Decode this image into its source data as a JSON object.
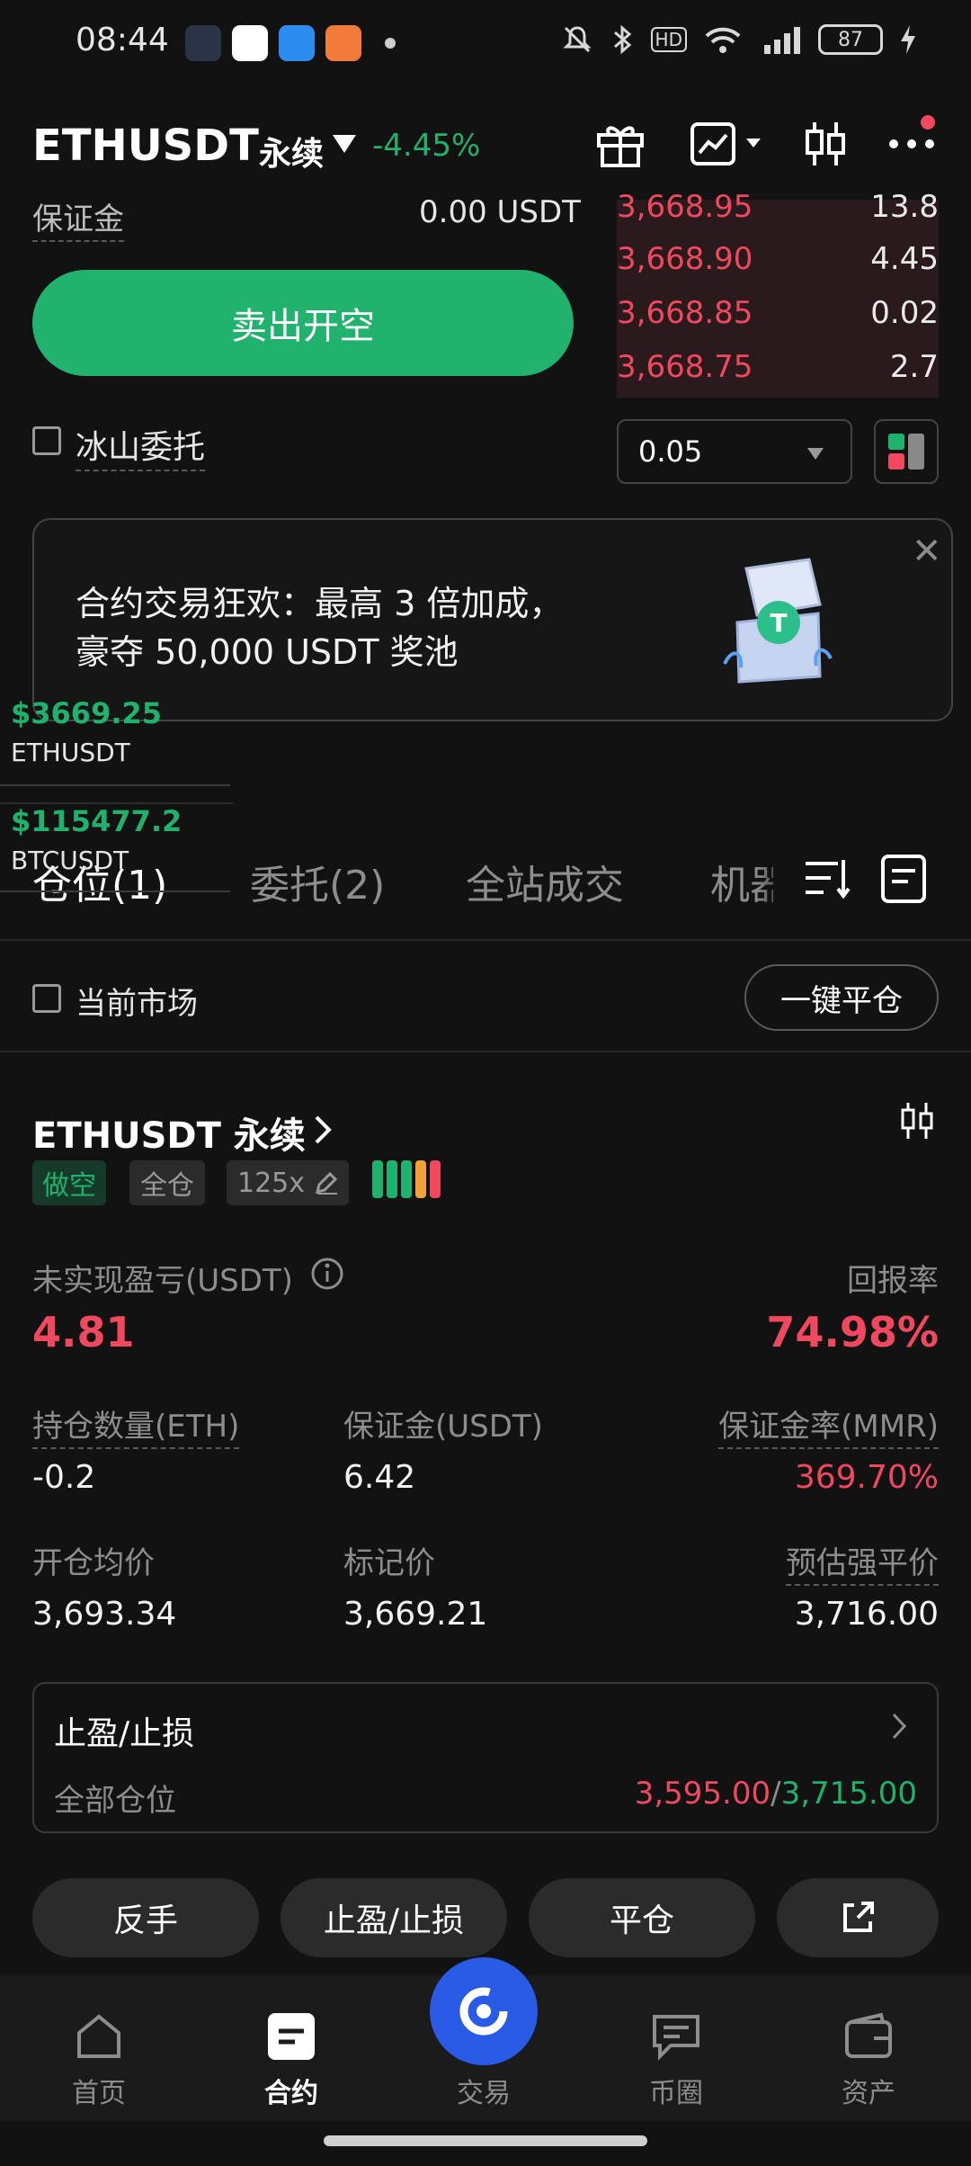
{
  "status_bar": {
    "time": "08:44",
    "battery": "87"
  },
  "header": {
    "symbol": "ETHUSDT",
    "contract_type": "永续",
    "change_pct": "-4.45%"
  },
  "order_panel": {
    "margin_label": "保证金",
    "margin_value": "0.00 USDT",
    "sell_button": "卖出开空",
    "iceberg_label": "冰山委托"
  },
  "orderbook": {
    "asks": [
      {
        "price": "3,668.95",
        "qty": "13.8"
      },
      {
        "price": "3,668.90",
        "qty": "4.45"
      },
      {
        "price": "3,668.85",
        "qty": "0.02"
      },
      {
        "price": "3,668.75",
        "qty": "2.7"
      }
    ],
    "depth_value": "0.05"
  },
  "promo": {
    "line1": "合约交易狂欢：最高 3 倍加成，",
    "line2": "豪夺 50,000 USDT 奖池"
  },
  "tickers": [
    {
      "price": "$3669.25",
      "name": "ETHUSDT"
    },
    {
      "price": "$115477.2",
      "name": "BTCUSDT"
    }
  ],
  "tabs": [
    {
      "label": "仓位(1)"
    },
    {
      "label": "委托(2)"
    },
    {
      "label": "全站成交"
    },
    {
      "label": "机器"
    }
  ],
  "filter": {
    "current_market": "当前市场",
    "close_all": "一键平仓"
  },
  "position": {
    "symbol": "ETHUSDT 永续",
    "side": "做空",
    "margin_mode": "全仓",
    "leverage": "125x",
    "pnl_label": "未实现盈亏(USDT)",
    "pnl_value": "4.81",
    "roe_label": "回报率",
    "roe_value": "74.98%",
    "size_label": "持仓数量(ETH)",
    "size_value": "-0.2",
    "margin_label": "保证金(USDT)",
    "margin_value": "6.42",
    "mmr_label": "保证金率(MMR)",
    "mmr_value": "369.70%",
    "entry_label": "开仓均价",
    "entry_value": "3,693.34",
    "mark_label": "标记价",
    "mark_value": "3,669.21",
    "liq_label": "预估强平价",
    "liq_value": "3,716.00",
    "tpsl_title": "止盈/止损",
    "tpsl_scope": "全部仓位",
    "tp_value": "3,595.00",
    "sl_value": "3,715.00",
    "tpsl_sep": "/"
  },
  "actions": {
    "reverse": "反手",
    "tpsl": "止盈/止损",
    "close": "平仓"
  },
  "bottom_nav": [
    {
      "label": "首页"
    },
    {
      "label": "合约"
    },
    {
      "label": "交易"
    },
    {
      "label": "币圈"
    },
    {
      "label": "资产"
    }
  ],
  "colors": {
    "green": "#20b26c",
    "red": "#f0495f",
    "brand_blue": "#2a5be7"
  }
}
